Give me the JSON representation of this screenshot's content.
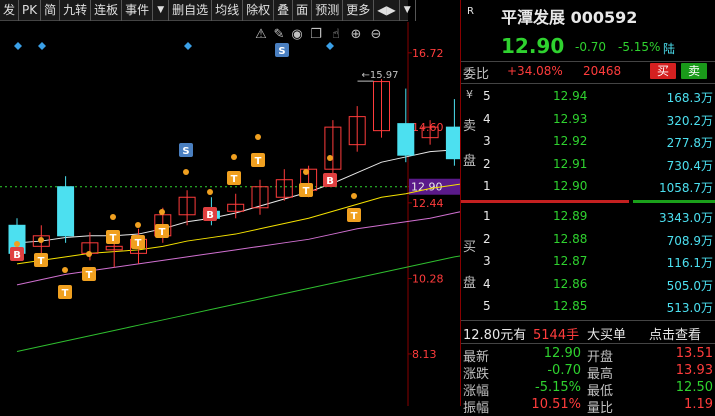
{
  "toolbar": {
    "items": [
      "发",
      "PK",
      "简",
      "九转",
      "连板",
      "事件",
      "▼",
      "删自选",
      "均线",
      "除权",
      "叠",
      "面",
      "预测",
      "更多",
      "◀▶",
      "▼"
    ]
  },
  "chart": {
    "price_labels": [
      "16.72",
      "14.60",
      "12.90",
      "12.44",
      "10.28",
      "8.13"
    ],
    "current_price_tag": "12.90",
    "high_annotation": "15.97",
    "icons": [
      "triangle-warning-icon",
      "pencil-icon",
      "eye-icon",
      "copy-icon",
      "hand-icon",
      "plus-circle-icon",
      "minus-circle-icon"
    ],
    "badge_b": "B",
    "badge_s": "S",
    "badge_t": "T"
  },
  "chart_data": {
    "type": "candlestick",
    "candles": [
      {
        "o": 11.8,
        "c": 11.0,
        "h": 12.0,
        "l": 10.9
      },
      {
        "o": 11.2,
        "c": 11.5,
        "h": 11.8,
        "l": 10.9
      },
      {
        "o": 12.9,
        "c": 11.5,
        "h": 13.2,
        "l": 11.3
      },
      {
        "o": 11.0,
        "c": 11.3,
        "h": 11.6,
        "l": 10.8
      },
      {
        "o": 11.1,
        "c": 11.2,
        "h": 11.6,
        "l": 10.6
      },
      {
        "o": 11.0,
        "c": 11.4,
        "h": 11.7,
        "l": 10.7
      },
      {
        "o": 11.5,
        "c": 12.1,
        "h": 12.3,
        "l": 11.3
      },
      {
        "o": 12.1,
        "c": 12.6,
        "h": 12.8,
        "l": 11.8
      },
      {
        "o": 12.2,
        "c": 12.0,
        "h": 12.6,
        "l": 11.8
      },
      {
        "o": 12.2,
        "c": 12.4,
        "h": 12.7,
        "l": 12.0
      },
      {
        "o": 12.3,
        "c": 12.9,
        "h": 13.1,
        "l": 12.1
      },
      {
        "o": 12.6,
        "c": 13.1,
        "h": 13.4,
        "l": 12.5
      },
      {
        "o": 12.8,
        "c": 13.4,
        "h": 13.5,
        "l": 12.6
      },
      {
        "o": 13.4,
        "c": 14.6,
        "h": 14.8,
        "l": 13.2
      },
      {
        "o": 14.1,
        "c": 14.9,
        "h": 15.2,
        "l": 13.9
      },
      {
        "o": 14.5,
        "c": 15.9,
        "h": 15.97,
        "l": 14.3
      },
      {
        "o": 14.7,
        "c": 13.8,
        "h": 15.7,
        "l": 13.6
      },
      {
        "o": 14.3,
        "c": 14.6,
        "h": 14.8,
        "l": 14.1
      },
      {
        "o": 14.6,
        "c": 13.7,
        "h": 15.4,
        "l": 13.5
      },
      {
        "o": 13.6,
        "c": 12.9,
        "h": 14.0,
        "l": 12.4
      }
    ],
    "ma_series": [
      {
        "values": [
          11.3,
          11.35,
          11.45,
          11.5,
          11.5,
          11.55,
          11.7,
          11.9,
          12.0,
          12.15,
          12.35,
          12.55,
          12.75,
          13.0,
          13.3,
          13.6,
          13.75,
          13.9,
          13.95,
          13.8
        ],
        "color": "#e8e8e8"
      },
      {
        "values": [
          10.7,
          10.8,
          10.9,
          11.0,
          11.05,
          11.1,
          11.2,
          11.35,
          11.45,
          11.55,
          11.7,
          11.85,
          12.0,
          12.2,
          12.4,
          12.6,
          12.7,
          12.85,
          12.95,
          13.05
        ],
        "color": "#f5e200"
      },
      {
        "values": [
          10.1,
          10.25,
          10.4,
          10.5,
          10.6,
          10.7,
          10.8,
          10.9,
          11.0,
          11.1,
          11.2,
          11.3,
          11.4,
          11.55,
          11.7,
          11.8,
          11.9,
          12.0,
          12.15,
          12.3
        ],
        "color": "#d070d0"
      },
      {
        "values": [
          8.2,
          8.35,
          8.5,
          8.65,
          8.8,
          8.95,
          9.1,
          9.25,
          9.4,
          9.55,
          9.7,
          9.85,
          10.0,
          10.15,
          10.3,
          10.45,
          10.6,
          10.75,
          10.9,
          11.0
        ],
        "color": "#2fbf2f"
      }
    ],
    "ylim": [
      7.9,
      17.2
    ],
    "price_ticks": [
      16.72,
      14.6,
      12.9,
      12.44,
      10.28,
      8.13
    ]
  },
  "quote": {
    "r_label": "R",
    "title": "平潭发展 000592",
    "price": "12.90",
    "change": "-0.70",
    "change_pct": "-5.15%",
    "exchange": "陆",
    "weibi_label": "委比",
    "weibi_pct": "+34.08%",
    "weibi_num": "20468",
    "buy_btn": "买",
    "sell_btn": "卖",
    "sell_yen": "¥",
    "sell_label_1": "卖",
    "sell_label_2": "盘",
    "buy_label_1": "买",
    "buy_label_2": "盘",
    "sell_orders": [
      {
        "level": "5",
        "price": "12.94",
        "vol": "168.3万"
      },
      {
        "level": "4",
        "price": "12.93",
        "vol": "320.2万"
      },
      {
        "level": "3",
        "price": "12.92",
        "vol": "277.8万"
      },
      {
        "level": "2",
        "price": "12.91",
        "vol": "730.4万"
      },
      {
        "level": "1",
        "price": "12.90",
        "vol": "1058.7万"
      }
    ],
    "buy_orders": [
      {
        "level": "1",
        "price": "12.89",
        "vol": "3343.0万"
      },
      {
        "level": "2",
        "price": "12.88",
        "vol": "708.9万"
      },
      {
        "level": "3",
        "price": "12.87",
        "vol": "116.1万"
      },
      {
        "level": "4",
        "price": "12.86",
        "vol": "505.0万"
      },
      {
        "level": "5",
        "price": "12.85",
        "vol": "513.0万"
      }
    ],
    "big_order_price": "12.80元有",
    "big_order_vol": "5144手",
    "big_order_label": "大买单",
    "big_order_link": "点击查看",
    "stats": [
      {
        "l1": "最新",
        "v1": "12.90",
        "l2": "开盘",
        "v2": "13.51"
      },
      {
        "l1": "涨跌",
        "v1": "-0.70",
        "l2": "最高",
        "v2": "13.93"
      },
      {
        "l1": "涨幅",
        "v1": "-5.15%",
        "l2": "最低",
        "v2": "12.50"
      },
      {
        "l1": "振幅",
        "v1": "10.51%",
        "l2": "量比",
        "v2": "1.19"
      }
    ]
  }
}
